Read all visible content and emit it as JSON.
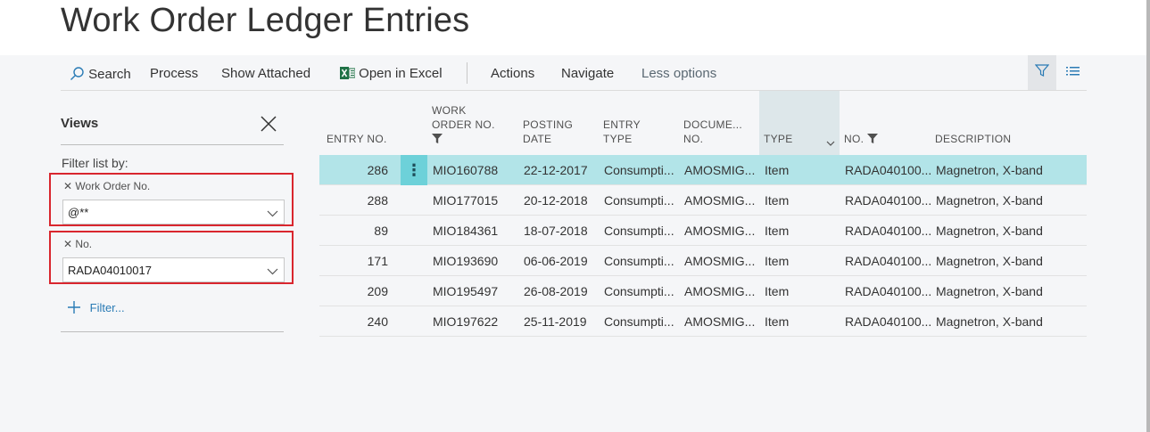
{
  "page": {
    "title": "Work Order Ledger Entries"
  },
  "actionbar": {
    "search": "Search",
    "process": "Process",
    "show_attached": "Show Attached",
    "open_in_excel": "Open in Excel",
    "actions": "Actions",
    "navigate": "Navigate",
    "less_options": "Less options"
  },
  "views": {
    "title": "Views",
    "filter_list_by": "Filter list by:",
    "filters": [
      {
        "label": "Work Order No.",
        "value": "@**"
      },
      {
        "label": "No.",
        "value": "RADA04010017"
      }
    ],
    "add_filter": "Filter..."
  },
  "table": {
    "columns": {
      "entry_no": "ENTRY NO.",
      "work_order_no_1": "WORK",
      "work_order_no_2": "ORDER NO.",
      "posting_date_1": "POSTING",
      "posting_date_2": "DATE",
      "entry_type_1": "ENTRY",
      "entry_type_2": "TYPE",
      "document_no_1": "DOCUME...",
      "document_no_2": "NO.",
      "type": "TYPE",
      "no": "NO.",
      "description": "DESCRIPTION"
    },
    "rows": [
      {
        "entry_no": "286",
        "work_order_no": "MIO160788",
        "posting_date": "22-12-2017",
        "entry_type": "Consumpti...",
        "document_no": "AMOSMIG...",
        "type": "Item",
        "no": "RADA040100...",
        "description": "Magnetron, X-band"
      },
      {
        "entry_no": "288",
        "work_order_no": "MIO177015",
        "posting_date": "20-12-2018",
        "entry_type": "Consumpti...",
        "document_no": "AMOSMIG...",
        "type": "Item",
        "no": "RADA040100...",
        "description": "Magnetron, X-band"
      },
      {
        "entry_no": "89",
        "work_order_no": "MIO184361",
        "posting_date": "18-07-2018",
        "entry_type": "Consumpti...",
        "document_no": "AMOSMIG...",
        "type": "Item",
        "no": "RADA040100...",
        "description": "Magnetron, X-band"
      },
      {
        "entry_no": "171",
        "work_order_no": "MIO193690",
        "posting_date": "06-06-2019",
        "entry_type": "Consumpti...",
        "document_no": "AMOSMIG...",
        "type": "Item",
        "no": "RADA040100...",
        "description": "Magnetron, X-band"
      },
      {
        "entry_no": "209",
        "work_order_no": "MIO195497",
        "posting_date": "26-08-2019",
        "entry_type": "Consumpti...",
        "document_no": "AMOSMIG...",
        "type": "Item",
        "no": "RADA040100...",
        "description": "Magnetron, X-band"
      },
      {
        "entry_no": "240",
        "work_order_no": "MIO197622",
        "posting_date": "25-11-2019",
        "entry_type": "Consumpti...",
        "document_no": "AMOSMIG...",
        "type": "Item",
        "no": "RADA040100...",
        "description": "Magnetron, X-band"
      }
    ]
  },
  "colors": {
    "selected_row": "#b2e4e8",
    "row_menu": "#6dd1d9",
    "filter_highlight": "#d9262e",
    "excel_green": "#1e7145",
    "link_blue": "#2a7bb5"
  }
}
